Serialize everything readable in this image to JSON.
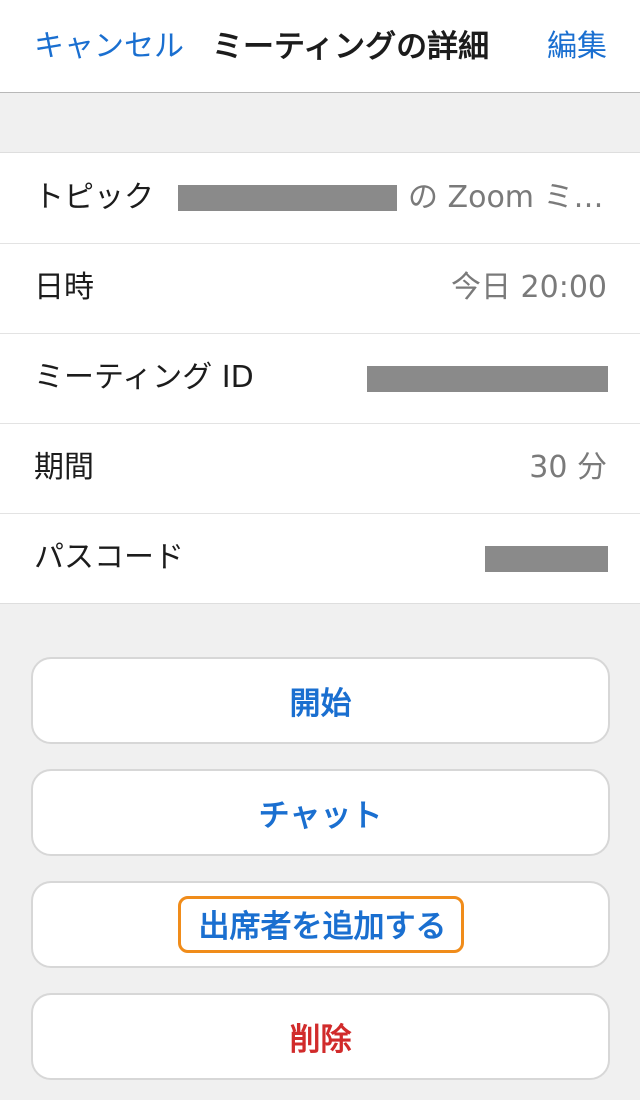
{
  "navbar": {
    "cancel_label": "キャンセル",
    "title": "ミーティングの詳細",
    "edit_label": "編集"
  },
  "details": {
    "topic": {
      "label": "トピック",
      "value": "の Zoom ミ…"
    },
    "datetime": {
      "label": "日時",
      "value": "今日 20:00"
    },
    "meeting_id": {
      "label": "ミーティング ID",
      "value": ""
    },
    "duration": {
      "label": "期間",
      "value": "30 分"
    },
    "passcode": {
      "label": "パスコード",
      "value": ""
    }
  },
  "actions": {
    "start_label": "開始",
    "chat_label": "チャット",
    "add_attendees_label": "出席者を追加する",
    "delete_label": "削除"
  },
  "colors": {
    "accent": "#1a6fd0",
    "danger": "#d12b2b",
    "highlight": "#f08c1a",
    "redaction": "#8a8a8a"
  }
}
